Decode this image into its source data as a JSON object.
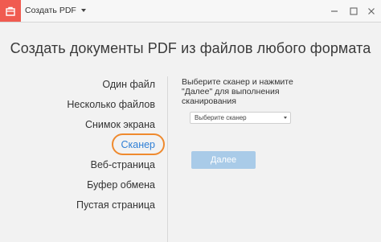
{
  "window": {
    "title": "Создать PDF",
    "controls": [
      "minimize-icon",
      "maximize-icon",
      "close-icon"
    ]
  },
  "main": {
    "heading": "Создать документы PDF из файлов любого формата"
  },
  "sidebar": {
    "items": [
      {
        "label": "Один файл",
        "active": false
      },
      {
        "label": "Несколько файлов",
        "active": false
      },
      {
        "label": "Снимок экрана",
        "active": false
      },
      {
        "label": "Сканер",
        "active": true
      },
      {
        "label": "Веб-страница",
        "active": false
      },
      {
        "label": "Буфер обмена",
        "active": false
      },
      {
        "label": "Пустая страница",
        "active": false
      }
    ]
  },
  "scanner_panel": {
    "instructions": "Выберите сканер и нажмите \"Далее\" для выполнения сканирования",
    "select_value": "Выберите сканер",
    "next_label": "Далее",
    "next_enabled": false
  },
  "colors": {
    "brand": "#f05b50",
    "active_text": "#2f7fd6",
    "highlight_ring": "#ef8a2e",
    "disabled_button": "#a9cbe8"
  }
}
